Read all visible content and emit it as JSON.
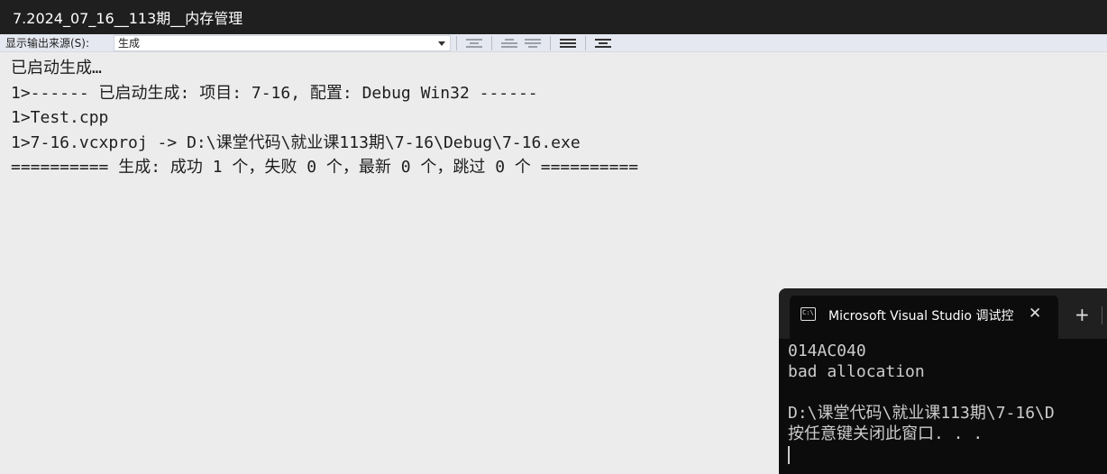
{
  "window": {
    "title": "7.2024_07_16__113期__内存管理"
  },
  "toolbar": {
    "source_label": "显示输出来源(S):",
    "source_value": "生成"
  },
  "output": {
    "lines": [
      "已启动生成…",
      "1>------ 已启动生成: 项目: 7-16, 配置: Debug Win32 ------",
      "1>Test.cpp",
      "1>7-16.vcxproj -> D:\\课堂代码\\就业课113期\\7-16\\Debug\\7-16.exe",
      "========== 生成: 成功 1 个，失败 0 个，最新 0 个，跳过 0 个 =========="
    ]
  },
  "console": {
    "tab_title": "Microsoft Visual Studio 调试控",
    "close_glyph": "✕",
    "new_tab_glyph": "+",
    "icon_text": "C:\\",
    "lines": [
      "014AC040",
      "bad allocation",
      "",
      "D:\\课堂代码\\就业课113期\\7-16\\D",
      "按任意键关闭此窗口. . ."
    ]
  }
}
